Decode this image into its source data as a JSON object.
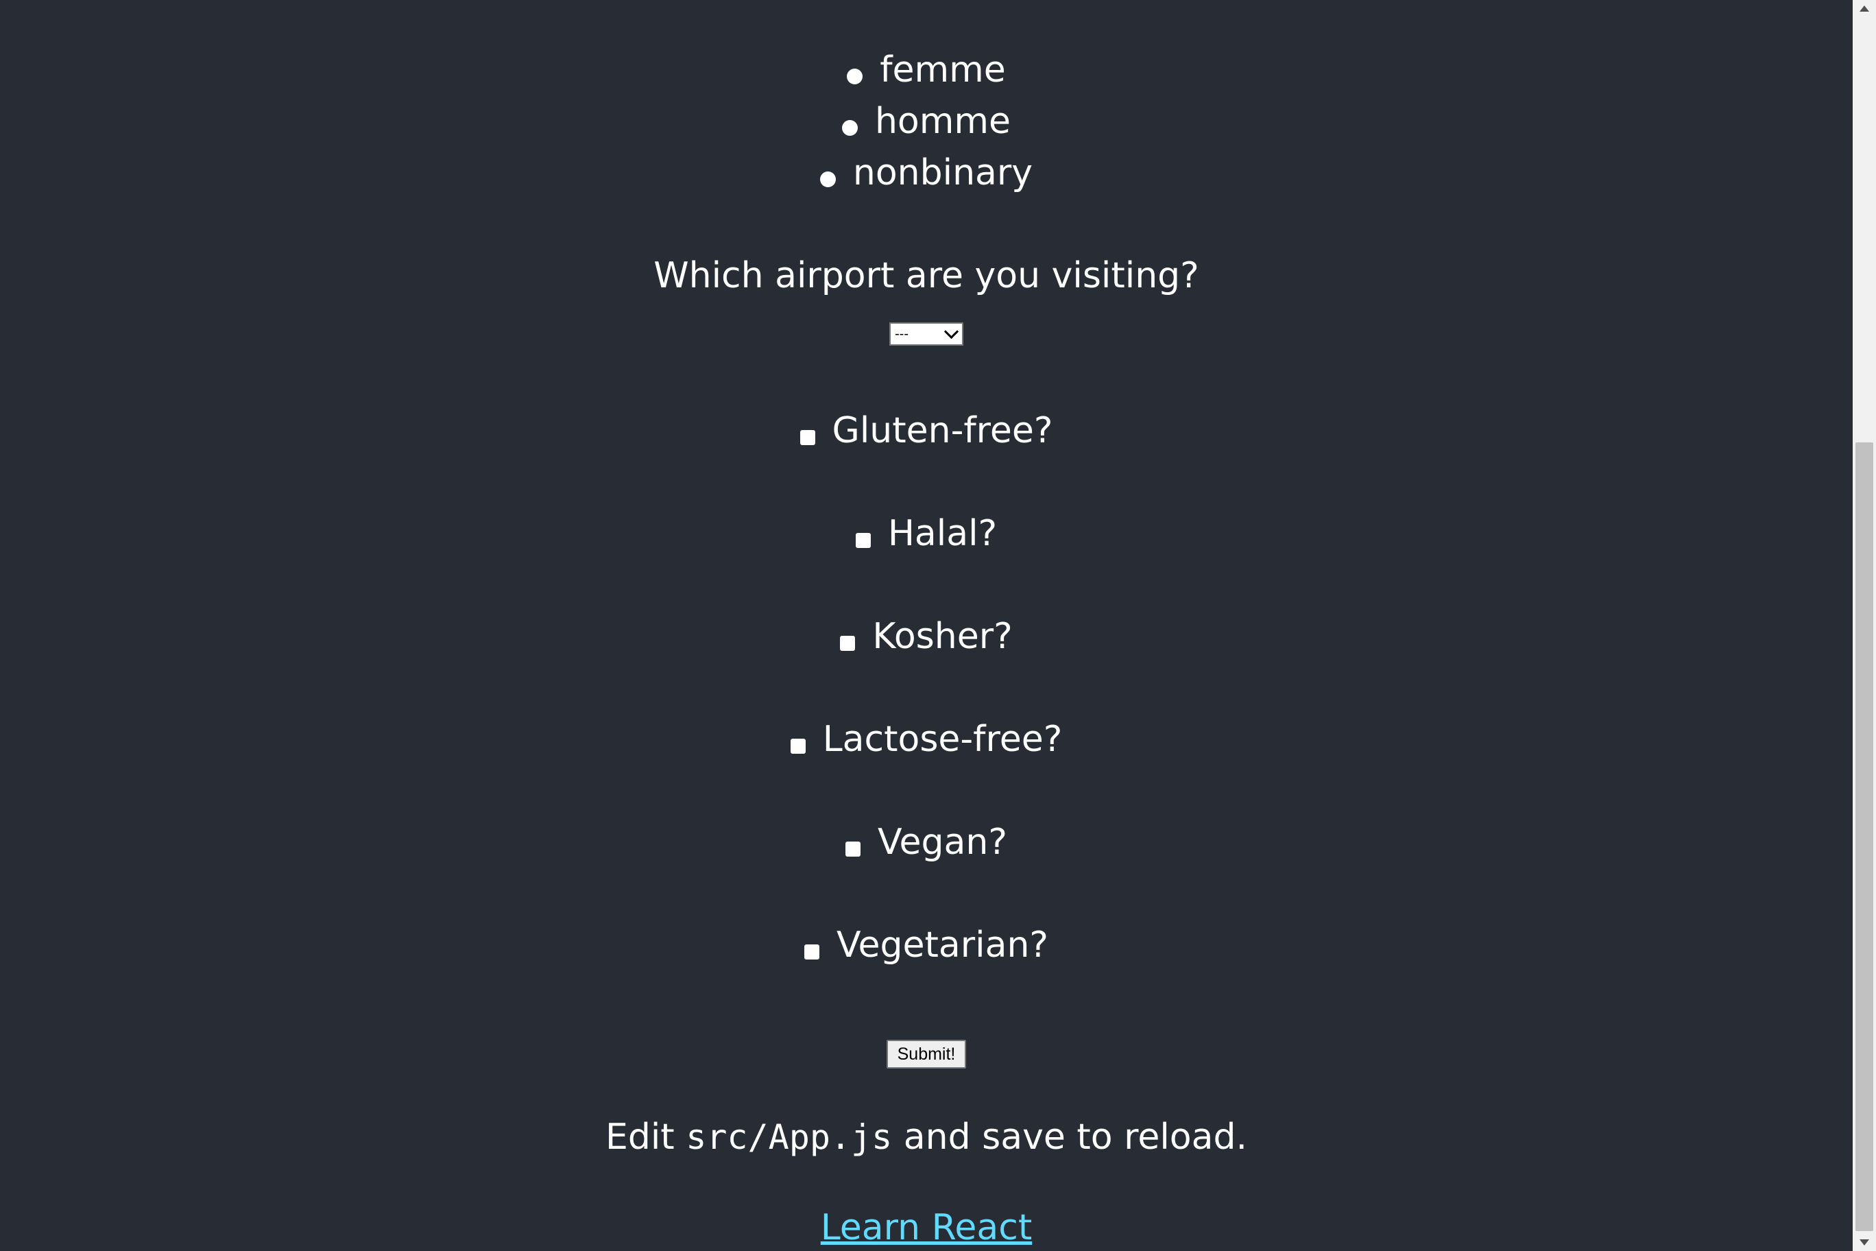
{
  "gender_options": [
    {
      "label": "femme"
    },
    {
      "label": "homme"
    },
    {
      "label": "nonbinary"
    }
  ],
  "airport": {
    "question": "Which airport are you visiting?",
    "selected": "---"
  },
  "diet_options": [
    {
      "label": "Gluten-free?"
    },
    {
      "label": "Halal?"
    },
    {
      "label": "Kosher?"
    },
    {
      "label": "Lactose-free?"
    },
    {
      "label": "Vegan?"
    },
    {
      "label": "Vegetarian?"
    }
  ],
  "submit_label": "Submit!",
  "edit_line": {
    "before": "Edit ",
    "code": "src/App.js",
    "after": " and save to reload."
  },
  "learn_link": "Learn React",
  "colors": {
    "background": "#282c34",
    "link": "#61dafb",
    "text": "#ffffff"
  }
}
